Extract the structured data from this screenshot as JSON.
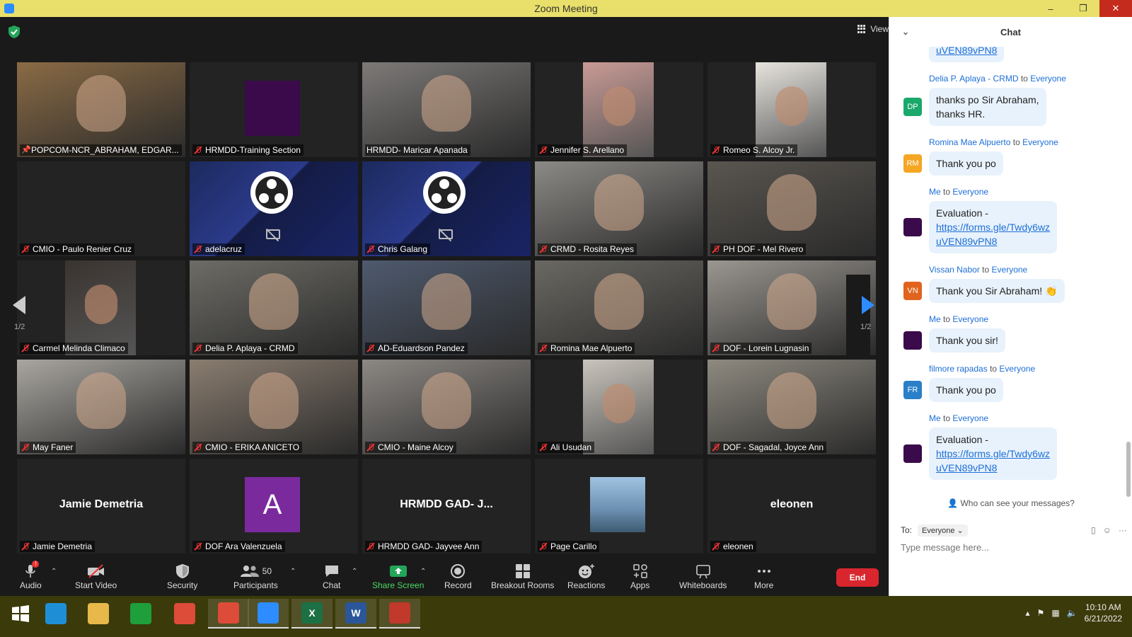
{
  "window": {
    "title": "Zoom Meeting",
    "minimize": "–",
    "restore": "❐",
    "close": "✕"
  },
  "view_label": "View",
  "pager": {
    "left": "1/2",
    "right": "1/2"
  },
  "tiles": [
    {
      "name": "POPCOM-NCR_ABRAHAM, EDGAR...",
      "kind": "video",
      "bg": "#8a6b45",
      "active": true,
      "pinned": true
    },
    {
      "name": "HRMDD-Training Section",
      "kind": "square",
      "square_color": "#3a0a4a"
    },
    {
      "name": "HRMDD- Maricar Apanada",
      "kind": "video",
      "bg": "#7d7a78",
      "unmuted": true
    },
    {
      "name": "Jennifer S. Arellano",
      "kind": "video_narrow",
      "bg": "#c99a95"
    },
    {
      "name": "Romeo S. Alcoy Jr.",
      "kind": "video_narrow",
      "bg": "#e7e4de"
    },
    {
      "name": "CMIO - Paulo Renier Cruz",
      "kind": "empty"
    },
    {
      "name": "adelacruz",
      "kind": "obs"
    },
    {
      "name": "Chris Galang",
      "kind": "obs"
    },
    {
      "name": "CRMD - Rosita Reyes",
      "kind": "video",
      "bg": "#8c8a86"
    },
    {
      "name": "PH DOF - Mel Rivero",
      "kind": "video",
      "bg": "#5a5650"
    },
    {
      "name": "Carmel Melinda Climaco",
      "kind": "video_narrow",
      "bg": "#3a3430"
    },
    {
      "name": "Delia P. Aplaya - CRMD",
      "kind": "video",
      "bg": "#6d6c66"
    },
    {
      "name": "AD-Eduardson Pandez",
      "kind": "video",
      "bg": "#4e5a6e"
    },
    {
      "name": "Romina Mae Alpuerto",
      "kind": "video",
      "bg": "#6a6862"
    },
    {
      "name": "DOF - Lorein Lugnasin",
      "kind": "video",
      "bg": "#9a9690"
    },
    {
      "name": "May Faner",
      "kind": "video",
      "bg": "#a9a6a0"
    },
    {
      "name": "CMIO - ERIKA ANICETO",
      "kind": "video",
      "bg": "#8a7d70"
    },
    {
      "name": "CMIO - Maine Alcoy",
      "kind": "video",
      "bg": "#8c8884"
    },
    {
      "name": "Ali Usudan",
      "kind": "video_narrow",
      "bg": "#c9c4bc"
    },
    {
      "name": "DOF - Sagadal, Joyce Ann",
      "kind": "video",
      "bg": "#8e8a80"
    },
    {
      "name": "Jamie Demetria",
      "kind": "nametile",
      "display": "Jamie Demetria"
    },
    {
      "name": "DOF Ara Valenzuela",
      "kind": "letter",
      "letter": "A",
      "square_color": "#7b2a9e"
    },
    {
      "name": "HRMDD GAD- Jayvee Ann",
      "kind": "nametile",
      "display": "HRMDD GAD- J..."
    },
    {
      "name": "Page Carillo",
      "kind": "picture",
      "square_color": "#6b8fb0"
    },
    {
      "name": "eleonen",
      "kind": "nametile",
      "display": "eleonen"
    }
  ],
  "toolbar": {
    "audio": "Audio",
    "start_video": "Start Video",
    "security": "Security",
    "participants": "Participants",
    "participants_count": "50",
    "chat": "Chat",
    "share_screen": "Share Screen",
    "record": "Record",
    "breakout_rooms": "Breakout Rooms",
    "reactions": "Reactions",
    "apps": "Apps",
    "whiteboards": "Whiteboards",
    "more": "More",
    "end": "End",
    "audio_badge": "!"
  },
  "chat": {
    "title": "Chat",
    "to_word": "to",
    "messages": [
      {
        "avatar": "",
        "avatar_color": "",
        "from": "",
        "target": "",
        "lines": [],
        "link": [
          "uVEN89vPN8"
        ]
      },
      {
        "avatar": "DP",
        "avatar_color": "#1aa86b",
        "from": "Delia P. Aplaya - CRMD",
        "target": "Everyone",
        "lines": [
          "thanks po Sir Abraham,",
          "thanks HR."
        ],
        "link": []
      },
      {
        "avatar": "RM",
        "avatar_color": "#f5a623",
        "from": "Romina Mae Alpuerto",
        "target": "Everyone",
        "lines": [
          "Thank you po"
        ],
        "link": []
      },
      {
        "avatar": "",
        "avatar_color": "#3a0a4a",
        "from": "Me",
        "target": "Everyone",
        "lines": [
          "Evaluation -"
        ],
        "link": [
          "https://forms.gle/Twdy6wz",
          "uVEN89vPN8"
        ]
      },
      {
        "avatar": "VN",
        "avatar_color": "#e0641e",
        "from": "Vissan Nabor",
        "target": "Everyone",
        "lines": [
          "Thank you Sir Abraham! 👏"
        ],
        "link": []
      },
      {
        "avatar": "",
        "avatar_color": "#3a0a4a",
        "from": "Me",
        "target": "Everyone",
        "lines": [
          "Thank you sir!"
        ],
        "link": []
      },
      {
        "avatar": "FR",
        "avatar_color": "#2a7fc9",
        "from": "filmore rapadas",
        "target": "Everyone",
        "lines": [
          "Thank you po"
        ],
        "link": []
      },
      {
        "avatar": "",
        "avatar_color": "#3a0a4a",
        "from": "Me",
        "target": "Everyone",
        "lines": [
          "Evaluation -"
        ],
        "link": [
          "https://forms.gle/Twdy6wz",
          "uVEN89vPN8"
        ]
      }
    ],
    "who_can_see": "Who can see your messages?",
    "to_label": "To:",
    "to_value": "Everyone",
    "placeholder": "Type message here..."
  },
  "taskbar": {
    "time": "10:10 AM",
    "date": "6/21/2022",
    "apps": [
      "Start",
      "Internet Explorer",
      "File Explorer",
      "Store",
      "Chrome",
      "Chrome Profile",
      "Zoom",
      "Excel",
      "Word",
      "Snipping Tool"
    ]
  }
}
